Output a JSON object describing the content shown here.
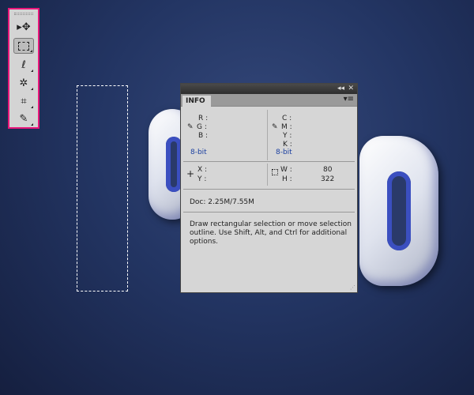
{
  "toolbar": {
    "tools": [
      {
        "name": "move-tool",
        "glyph": "▸✥"
      },
      {
        "name": "rectangular-marquee-tool",
        "glyph": "⬚",
        "selected": true
      },
      {
        "name": "lasso-tool",
        "glyph": "ℓ"
      },
      {
        "name": "magic-wand-tool",
        "glyph": "✲"
      },
      {
        "name": "crop-tool",
        "glyph": "⌗"
      },
      {
        "name": "eyedropper-tool",
        "glyph": "✎"
      }
    ],
    "highlight_color": "#e8177a"
  },
  "panel": {
    "tab": "INFO",
    "collapse": "◂◂",
    "close": "✕",
    "menu": "▾≡",
    "rgb": {
      "r": "R :",
      "g": "G :",
      "b": "B :",
      "depth": "8-bit"
    },
    "cmyk": {
      "c": "C :",
      "m": "M :",
      "y": "Y :",
      "k": "K :",
      "depth": "8-bit"
    },
    "xy": {
      "x": "X :",
      "y": "Y :"
    },
    "wh": {
      "w": "W :",
      "h": "H :",
      "w_val": "80",
      "h_val": "322"
    },
    "doc": "Doc: 2.25M/7.55M",
    "help": "Draw rectangular selection or move selection outline.  Use Shift, Alt, and Ctrl for additional options."
  }
}
